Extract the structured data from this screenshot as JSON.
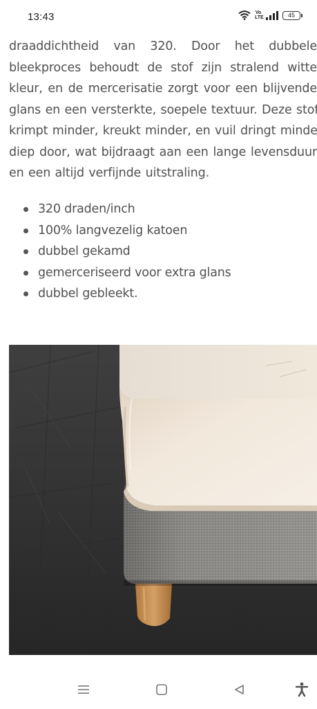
{
  "status_bar": {
    "time": "13:43",
    "volte_label": "Vo LTE",
    "battery_level": "45",
    "icons": [
      "wifi-icon",
      "volte-icon",
      "signal-icon",
      "battery-icon"
    ]
  },
  "article": {
    "paragraph_lines": [
      "draaddichtheid van 320. Door het dubbele",
      "bleekproces behoudt de stof zijn stralend witte",
      "kleur, en de mercerisatie zorgt voor een blijvende",
      "glans en een versterkte, soepele textuur. Deze stof",
      "krimpt minder, kreukt minder, en vuil dringt minder",
      "diep door, wat bijdraagt aan een lange levensduur",
      "en een altijd verfijnde uitstraling."
    ],
    "bullets": [
      "320 draden/inch",
      "100% langvezelig katoen",
      "dubbel gekamd",
      "gemerceriseerd voor extra glans",
      "dubbel gebleekt."
    ]
  },
  "photo": {
    "subject": "fitted-sheet-on-box-spring-photo",
    "colors": {
      "floor": "#3b3b3b",
      "sheet": "#efe6db",
      "base_fabric": "#8a8885",
      "leg": "#c8955a"
    }
  },
  "nav_bar": {
    "icons": [
      "menu-icon",
      "home-icon",
      "back-icon",
      "accessibility-icon"
    ]
  },
  "colors": {
    "text": "#505050",
    "bullet": "#555555",
    "background": "#ffffff"
  }
}
